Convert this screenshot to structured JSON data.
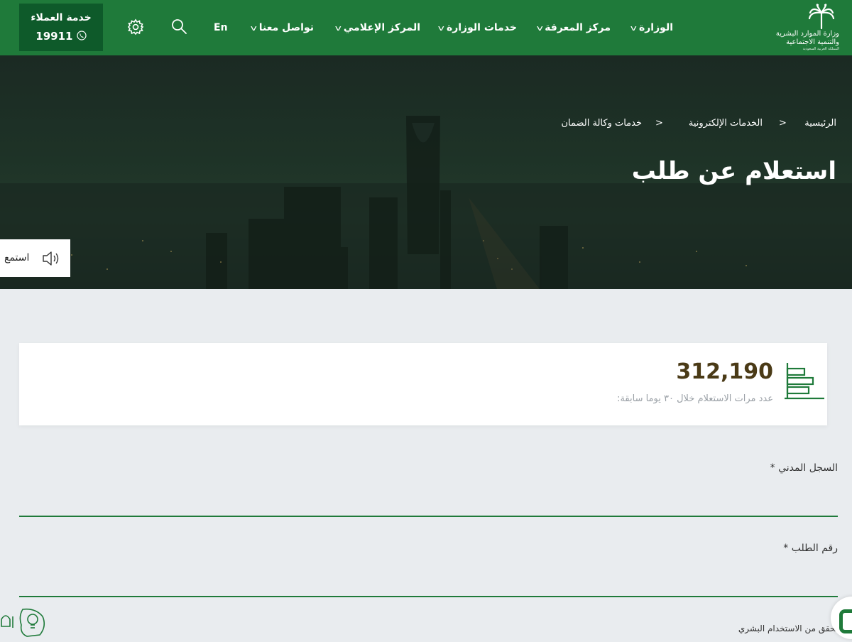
{
  "header": {
    "logo": {
      "line1": "وزارة الموارد البشرية",
      "line2": "والتنمية الاجتماعية",
      "line3": "المملكة العربية السعودية"
    },
    "nav": [
      {
        "label": "الوزارة"
      },
      {
        "label": "مركز المعرفة"
      },
      {
        "label": "خدمات الوزارة"
      },
      {
        "label": "المركز الإعلامي"
      },
      {
        "label": "تواصل معنا"
      }
    ],
    "language_label": "En",
    "hotline": {
      "title": "خدمة العملاء",
      "number": "19911"
    }
  },
  "hero": {
    "breadcrumb": [
      {
        "label": "الرئيسية"
      },
      {
        "label": "الخدمات الإلكترونية"
      },
      {
        "label": "خدمات وكالة الضمان"
      }
    ],
    "title": "استعلام عن طلب",
    "listen_label": "استمع"
  },
  "stats": {
    "count": "312,190",
    "caption": "عدد مرات الاستعلام خلال ٣٠ يوما سابقة:"
  },
  "form": {
    "civil_record": {
      "label": "السجل المدني *",
      "value": "",
      "placeholder": ""
    },
    "request_number": {
      "label": "رقم الطلب *",
      "value": "",
      "placeholder": ""
    },
    "captcha_label": "تحقق من الاستخدام البشري"
  },
  "colors": {
    "brand_green": "#1f7a3a",
    "hotline_bg": "#0e5a2a",
    "count_text": "#4a3a16"
  }
}
